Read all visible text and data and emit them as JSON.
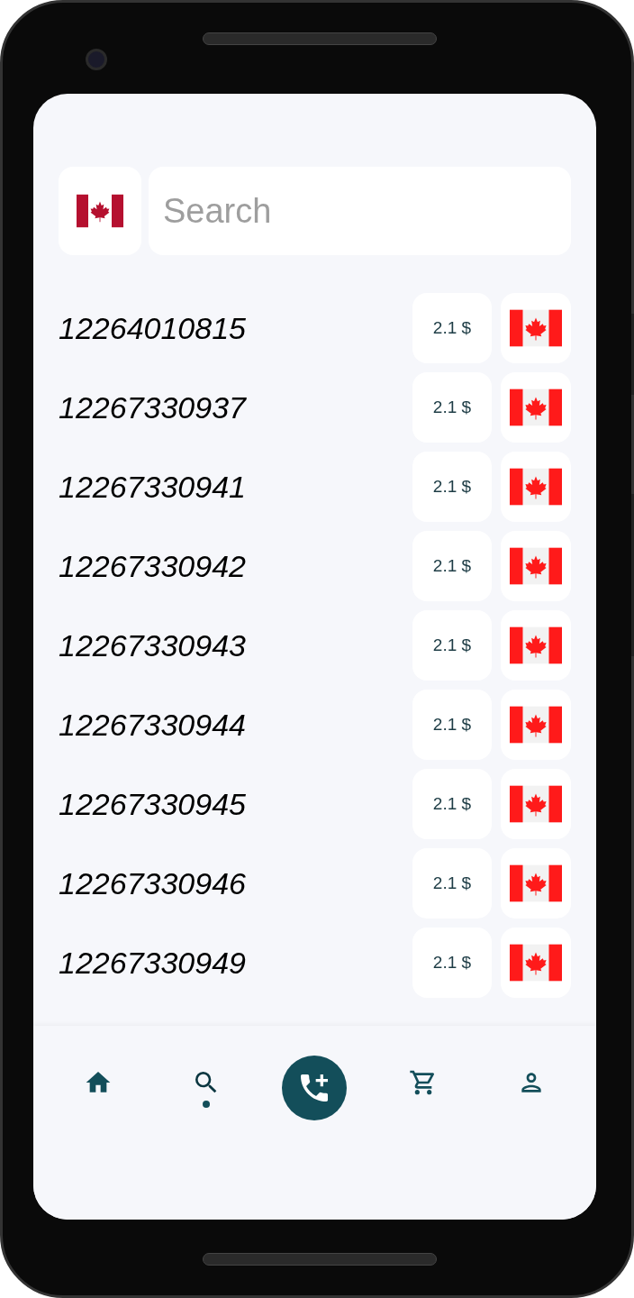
{
  "search": {
    "placeholder": "Search"
  },
  "numbers": [
    {
      "number": "12264010815",
      "price": "2.1 $"
    },
    {
      "number": "12267330937",
      "price": "2.1 $"
    },
    {
      "number": "12267330941",
      "price": "2.1 $"
    },
    {
      "number": "12267330942",
      "price": "2.1 $"
    },
    {
      "number": "12267330943",
      "price": "2.1 $"
    },
    {
      "number": "12267330944",
      "price": "2.1 $"
    },
    {
      "number": "12267330945",
      "price": "2.1 $"
    },
    {
      "number": "12267330946",
      "price": "2.1 $"
    },
    {
      "number": "12267330949",
      "price": "2.1 $"
    }
  ],
  "nav": [
    {
      "kind": "home",
      "selected": false
    },
    {
      "kind": "search",
      "selected": true
    },
    {
      "kind": "add-call",
      "selected": false
    },
    {
      "kind": "cart",
      "selected": false
    },
    {
      "kind": "profile",
      "selected": false
    }
  ]
}
